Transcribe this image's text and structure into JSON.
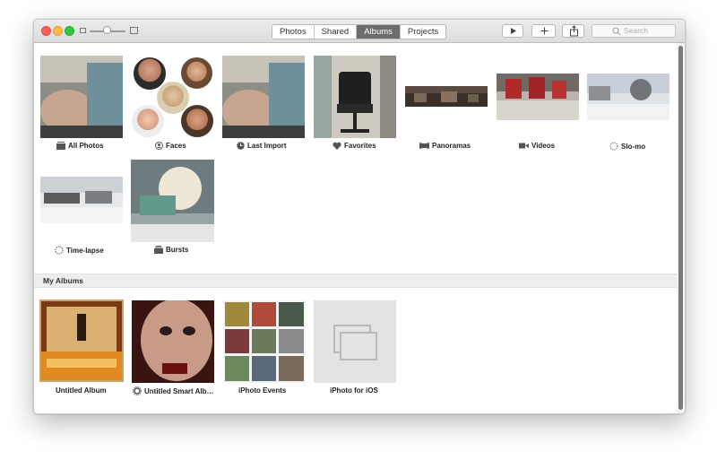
{
  "window": {
    "tabs": [
      {
        "label": "Photos",
        "active": false
      },
      {
        "label": "Shared",
        "active": false
      },
      {
        "label": "Albums",
        "active": true
      },
      {
        "label": "Projects",
        "active": false
      }
    ],
    "toolbar": {
      "play_icon": "play-icon",
      "add_icon": "plus-icon",
      "share_icon": "share-icon"
    },
    "search": {
      "placeholder": "Search",
      "icon": "search-icon"
    }
  },
  "albums": [
    {
      "label": "All Photos",
      "icon": "photos-stack-icon"
    },
    {
      "label": "Faces",
      "icon": "face-icon"
    },
    {
      "label": "Last Import",
      "icon": "clock-icon"
    },
    {
      "label": "Favorites",
      "icon": "heart-icon"
    },
    {
      "label": "Panoramas",
      "icon": "panorama-icon"
    },
    {
      "label": "Videos",
      "icon": "video-camera-icon"
    },
    {
      "label": "Slo-mo",
      "icon": "slo-mo-icon"
    },
    {
      "label": "Time-lapse",
      "icon": "time-lapse-icon"
    },
    {
      "label": "Bursts",
      "icon": "bursts-icon"
    }
  ],
  "my_albums": {
    "header": "My Albums",
    "items": [
      {
        "label": "Untitled Album",
        "selected": true
      },
      {
        "label": "Untitled Smart Alb…",
        "icon": "gear-icon"
      },
      {
        "label": "iPhoto Events"
      },
      {
        "label": "iPhoto for iOS"
      }
    ]
  },
  "colors": {
    "active_tab": "#6c6c6c",
    "close": "#fc605c",
    "minimize": "#fdbc40",
    "maximize": "#34c84a"
  }
}
